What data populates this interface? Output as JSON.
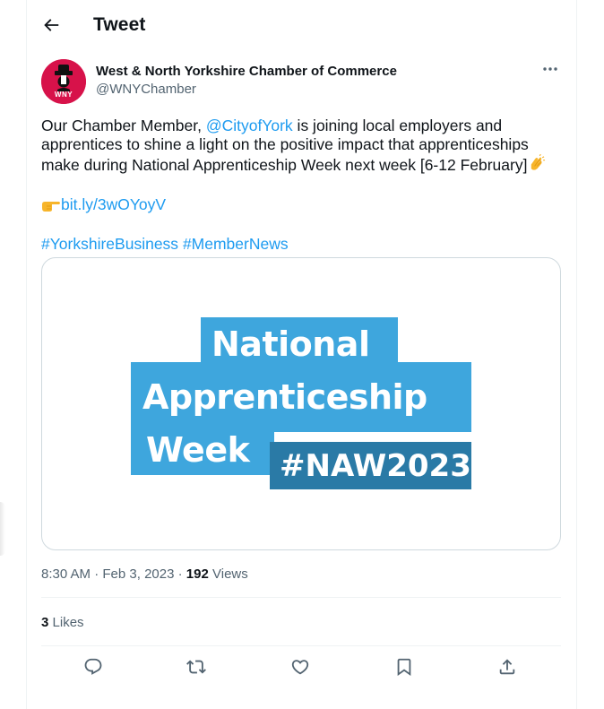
{
  "header": {
    "title": "Tweet"
  },
  "author": {
    "display_name": "West & North Yorkshire Chamber of Commerce",
    "handle": "@WNYChamber",
    "avatar_text": "WNY",
    "avatar_color": "#d7124a"
  },
  "tweet": {
    "text_before_mention": "Our Chamber Member, ",
    "mention": "@CityofYork",
    "text_after_mention": " is joining local employers and apprentices to shine a light on the positive impact that apprenticeships make during National Apprenticeship Week next week [6-12 February]",
    "link_text": "bit.ly/3wOYoyV",
    "hashtags": [
      "#YorkshireBusiness",
      "#MemberNews"
    ]
  },
  "media": {
    "line1": "National",
    "line2": "Apprenticeship",
    "line3": "Week",
    "tag": "#NAW2023",
    "color_light": "#3ea6dd",
    "color_dark": "#2a7aa6"
  },
  "meta": {
    "time": "8:30 AM",
    "date": "Feb 3, 2023",
    "views_count": "192",
    "views_label": "Views"
  },
  "stats": {
    "likes_count": "3",
    "likes_label": "Likes"
  },
  "colors": {
    "link": "#1d9bf0",
    "secondary_text": "#536471",
    "border": "#cfd9de"
  },
  "icons": [
    "back-arrow-icon",
    "more-icon",
    "reply-icon",
    "retweet-icon",
    "like-icon",
    "bookmark-icon",
    "share-icon"
  ]
}
